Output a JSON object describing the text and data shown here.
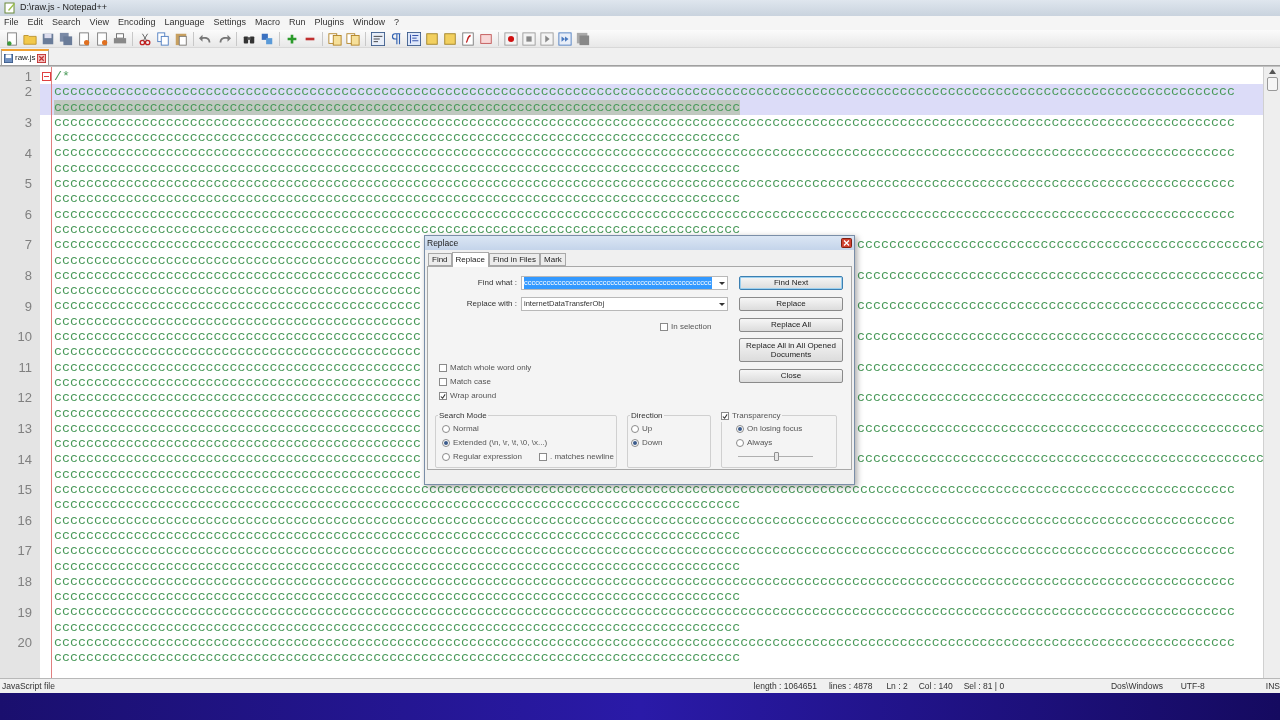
{
  "window": {
    "title": "D:\\raw.js - Notepad++"
  },
  "menu": [
    "File",
    "Edit",
    "Search",
    "View",
    "Encoding",
    "Language",
    "Settings",
    "Macro",
    "Run",
    "Plugins",
    "Window",
    "?"
  ],
  "tabs": [
    {
      "label": "raw.js",
      "selected": true
    }
  ],
  "editor": {
    "lines": [
      {
        "number": "1",
        "fold": true,
        "current": false,
        "rows": [
          {
            "kind": "full",
            "text": "/*",
            "selected": false
          }
        ]
      },
      {
        "number": "2",
        "fold": false,
        "current": true,
        "rows": [
          {
            "kind": "full",
            "text": "cccccccccccccccccccccccccccccccccccccccccccccccccccccccccccccccccccccccccccccccccccccccccccccccccccccccccccccccccccccccccccccccccccccccccccccccccccc",
            "selected": false
          },
          {
            "kind": "full",
            "text": "cccccccccccccccccccccccccccccccccccccccccccccccccccccccccccccccccccccccccccccccccccccc",
            "selected": true
          }
        ]
      },
      {
        "number": "3",
        "fold": false,
        "current": false,
        "rows": [
          {
            "kind": "full",
            "text": "cccccccccccccccccccccccccccccccccccccccccccccccccccccccccccccccccccccccccccccccccccccccccccccccccccccccccccccccccccccccccccccccccccccccccccccccccccc",
            "selected": false
          },
          {
            "kind": "full",
            "text": "cccccccccccccccccccccccccccccccccccccccccccccccccccccccccccccccccccccccccccccccccccccc",
            "selected": false
          }
        ]
      },
      {
        "number": "4",
        "fold": false,
        "current": false,
        "rows": [
          {
            "kind": "full",
            "text": "cccccccccccccccccccccccccccccccccccccccccccccccccccccccccccccccccccccccccccccccccccccccccccccccccccccccccccccccccccccccccccccccccccccccccccccccccccc",
            "selected": false
          },
          {
            "kind": "full",
            "text": "cccccccccccccccccccccccccccccccccccccccccccccccccccccccccccccccccccccccccccccccccccccc",
            "selected": false
          }
        ]
      },
      {
        "number": "5",
        "fold": false,
        "current": false,
        "rows": [
          {
            "kind": "full",
            "text": "cccccccccccccccccccccccccccccccccccccccccccccccccccccccccccccccccccccccccccccccccccccccccccccccccccccccccccccccccccccccccccccccccccccccccccccccccccc",
            "selected": false
          },
          {
            "kind": "full",
            "text": "cccccccccccccccccccccccccccccccccccccccccccccccccccccccccccccccccccccccccccccccccccccc",
            "selected": false
          }
        ]
      },
      {
        "number": "6",
        "fold": false,
        "current": false,
        "rows": [
          {
            "kind": "full",
            "text": "cccccccccccccccccccccccccccccccccccccccccccccccccccccccccccccccccccccccccccccccccccccccccccccccccccccccccccccccccccccccccccccccccccccccccccccccccccc",
            "selected": false
          },
          {
            "kind": "full",
            "text": "cccccccccccccccccccccccccccccccccccccccccccccccccccccccccccccccccccccccccccccccccccccc",
            "selected": false
          }
        ]
      },
      {
        "number": "7",
        "fold": false,
        "current": false,
        "rows": [
          {
            "kind": "split",
            "left": "cccccccccccccccccccccccccccccccccccccccccccccc",
            "right": "ccccccccccccccccccccccccccccccccccccccccccccccccccc",
            "selected": false
          },
          {
            "kind": "split",
            "left": "cccccccccccccccccccccccccccccccccccccccccccccc",
            "selected": false
          }
        ]
      },
      {
        "number": "8",
        "fold": false,
        "current": false,
        "rows": [
          {
            "kind": "split",
            "left": "cccccccccccccccccccccccccccccccccccccccccccccc",
            "right": "ccccccccccccccccccccccccccccccccccccccccccccccccccc",
            "selected": false
          },
          {
            "kind": "split",
            "left": "cccccccccccccccccccccccccccccccccccccccccccccc",
            "selected": false
          }
        ]
      },
      {
        "number": "9",
        "fold": false,
        "current": false,
        "rows": [
          {
            "kind": "split",
            "left": "cccccccccccccccccccccccccccccccccccccccccccccc",
            "right": "ccccccccccccccccccccccccccccccccccccccccccccccccccc",
            "selected": false
          },
          {
            "kind": "split",
            "left": "cccccccccccccccccccccccccccccccccccccccccccccc",
            "selected": false
          }
        ]
      },
      {
        "number": "10",
        "fold": false,
        "current": false,
        "rows": [
          {
            "kind": "split",
            "left": "cccccccccccccccccccccccccccccccccccccccccccccc",
            "right": "ccccccccccccccccccccccccccccccccccccccccccccccccccc",
            "selected": false
          },
          {
            "kind": "split",
            "left": "cccccccccccccccccccccccccccccccccccccccccccccc",
            "selected": false
          }
        ]
      },
      {
        "number": "11",
        "fold": false,
        "current": false,
        "rows": [
          {
            "kind": "split",
            "left": "cccccccccccccccccccccccccccccccccccccccccccccc",
            "right": "ccccccccccccccccccccccccccccccccccccccccccccccccccc",
            "selected": false
          },
          {
            "kind": "split",
            "left": "cccccccccccccccccccccccccccccccccccccccccccccc",
            "selected": false
          }
        ]
      },
      {
        "number": "12",
        "fold": false,
        "current": false,
        "rows": [
          {
            "kind": "split",
            "left": "cccccccccccccccccccccccccccccccccccccccccccccc",
            "right": "ccccccccccccccccccccccccccccccccccccccccccccccccccc",
            "selected": false
          },
          {
            "kind": "split",
            "left": "cccccccccccccccccccccccccccccccccccccccccccccc",
            "selected": false
          }
        ]
      },
      {
        "number": "13",
        "fold": false,
        "current": false,
        "rows": [
          {
            "kind": "split",
            "left": "cccccccccccccccccccccccccccccccccccccccccccccc",
            "right": "ccccccccccccccccccccccccccccccccccccccccccccccccccc",
            "selected": false
          },
          {
            "kind": "split",
            "left": "cccccccccccccccccccccccccccccccccccccccccccccc",
            "selected": false
          }
        ]
      },
      {
        "number": "14",
        "fold": false,
        "current": false,
        "rows": [
          {
            "kind": "split",
            "left": "cccccccccccccccccccccccccccccccccccccccccccccc",
            "right": "ccccccccccccccccccccccccccccccccccccccccccccccccccc",
            "selected": false
          },
          {
            "kind": "split",
            "left": "cccccccccccccccccccccccccccccccccccccccccccccc",
            "selected": false
          }
        ]
      },
      {
        "number": "15",
        "fold": false,
        "current": false,
        "rows": [
          {
            "kind": "full",
            "text": "cccccccccccccccccccccccccccccccccccccccccccccccccccccccccccccccccccccccccccccccccccccccccccccccccccccccccccccccccccccccccccccccccccccccccccccccccccc",
            "selected": false
          },
          {
            "kind": "full",
            "text": "cccccccccccccccccccccccccccccccccccccccccccccccccccccccccccccccccccccccccccccccccccccc",
            "selected": false
          }
        ]
      },
      {
        "number": "16",
        "fold": false,
        "current": false,
        "rows": [
          {
            "kind": "full",
            "text": "cccccccccccccccccccccccccccccccccccccccccccccccccccccccccccccccccccccccccccccccccccccccccccccccccccccccccccccccccccccccccccccccccccccccccccccccccccc",
            "selected": false
          },
          {
            "kind": "full",
            "text": "cccccccccccccccccccccccccccccccccccccccccccccccccccccccccccccccccccccccccccccccccccccc",
            "selected": false
          }
        ]
      },
      {
        "number": "17",
        "fold": false,
        "current": false,
        "rows": [
          {
            "kind": "full",
            "text": "cccccccccccccccccccccccccccccccccccccccccccccccccccccccccccccccccccccccccccccccccccccccccccccccccccccccccccccccccccccccccccccccccccccccccccccccccccc",
            "selected": false
          },
          {
            "kind": "full",
            "text": "cccccccccccccccccccccccccccccccccccccccccccccccccccccccccccccccccccccccccccccccccccccc",
            "selected": false
          }
        ]
      },
      {
        "number": "18",
        "fold": false,
        "current": false,
        "rows": [
          {
            "kind": "full",
            "text": "cccccccccccccccccccccccccccccccccccccccccccccccccccccccccccccccccccccccccccccccccccccccccccccccccccccccccccccccccccccccccccccccccccccccccccccccccccc",
            "selected": false
          },
          {
            "kind": "full",
            "text": "cccccccccccccccccccccccccccccccccccccccccccccccccccccccccccccccccccccccccccccccccccccc",
            "selected": false
          }
        ]
      },
      {
        "number": "19",
        "fold": false,
        "current": false,
        "rows": [
          {
            "kind": "full",
            "text": "cccccccccccccccccccccccccccccccccccccccccccccccccccccccccccccccccccccccccccccccccccccccccccccccccccccccccccccccccccccccccccccccccccccccccccccccccccc",
            "selected": false
          },
          {
            "kind": "full",
            "text": "cccccccccccccccccccccccccccccccccccccccccccccccccccccccccccccccccccccccccccccccccccccc",
            "selected": false
          }
        ]
      },
      {
        "number": "20",
        "fold": false,
        "current": false,
        "rows": [
          {
            "kind": "full",
            "text": "cccccccccccccccccccccccccccccccccccccccccccccccccccccccccccccccccccccccccccccccccccccccccccccccccccccccccccccccccccccccccccccccccccccccccccccccccccc",
            "selected": false
          },
          {
            "kind": "full",
            "text": "cccccccccccccccccccccccccccccccccccccccccccccccccccccccccccccccccccccccccccccccccccccc",
            "selected": false
          }
        ]
      }
    ]
  },
  "dialog": {
    "title": "Replace",
    "tabs": [
      {
        "label": "Find",
        "selected": false
      },
      {
        "label": "Replace",
        "selected": true
      },
      {
        "label": "Find in Files",
        "selected": false
      },
      {
        "label": "Mark",
        "selected": false
      }
    ],
    "find_what": {
      "label": "Find what :",
      "value": "cccccccccccccccccccccccccccccccccccccccccccccccccc"
    },
    "replace_with": {
      "label": "Replace with :",
      "value": "internetDataTransferObj"
    },
    "in_selection": {
      "label": "In selection",
      "checked": false
    },
    "buttons": [
      {
        "label": "Find Next",
        "focused": true
      },
      {
        "label": "Replace",
        "focused": false
      },
      {
        "label": "Replace All",
        "focused": false
      },
      {
        "label": "Replace All in All Opened Documents",
        "focused": false
      },
      {
        "label": "Close",
        "focused": false
      }
    ],
    "options": [
      {
        "label": "Match whole word only",
        "checked": false
      },
      {
        "label": "Match case",
        "checked": false
      },
      {
        "label": "Wrap around",
        "checked": true
      }
    ],
    "search_mode": {
      "title": "Search Mode",
      "radios": [
        {
          "label": "Normal",
          "selected": false
        },
        {
          "label": "Extended (\\n, \\r, \\t, \\0, \\x...)",
          "selected": true
        },
        {
          "label": "Regular expression",
          "selected": false
        }
      ],
      "matches_newline": {
        "label": ". matches newline",
        "checked": false
      }
    },
    "direction": {
      "title": "Direction",
      "radios": [
        {
          "label": "Up",
          "selected": false
        },
        {
          "label": "Down",
          "selected": true
        }
      ]
    },
    "transparency": {
      "label": "Transparency",
      "checked": true,
      "radios": [
        {
          "label": "On losing focus",
          "selected": true
        },
        {
          "label": "Always",
          "selected": false
        }
      ],
      "level": 0.5
    }
  },
  "status_bar": {
    "file_type": "JavaScript file",
    "length": "length : 1064651",
    "lines": "lines : 4878",
    "ln": "Ln : 2",
    "col": "Col : 140",
    "sel": "Sel : 81 | 0",
    "eol": "Dos\\Windows",
    "encoding": "UTF-8",
    "mode": "INS"
  }
}
